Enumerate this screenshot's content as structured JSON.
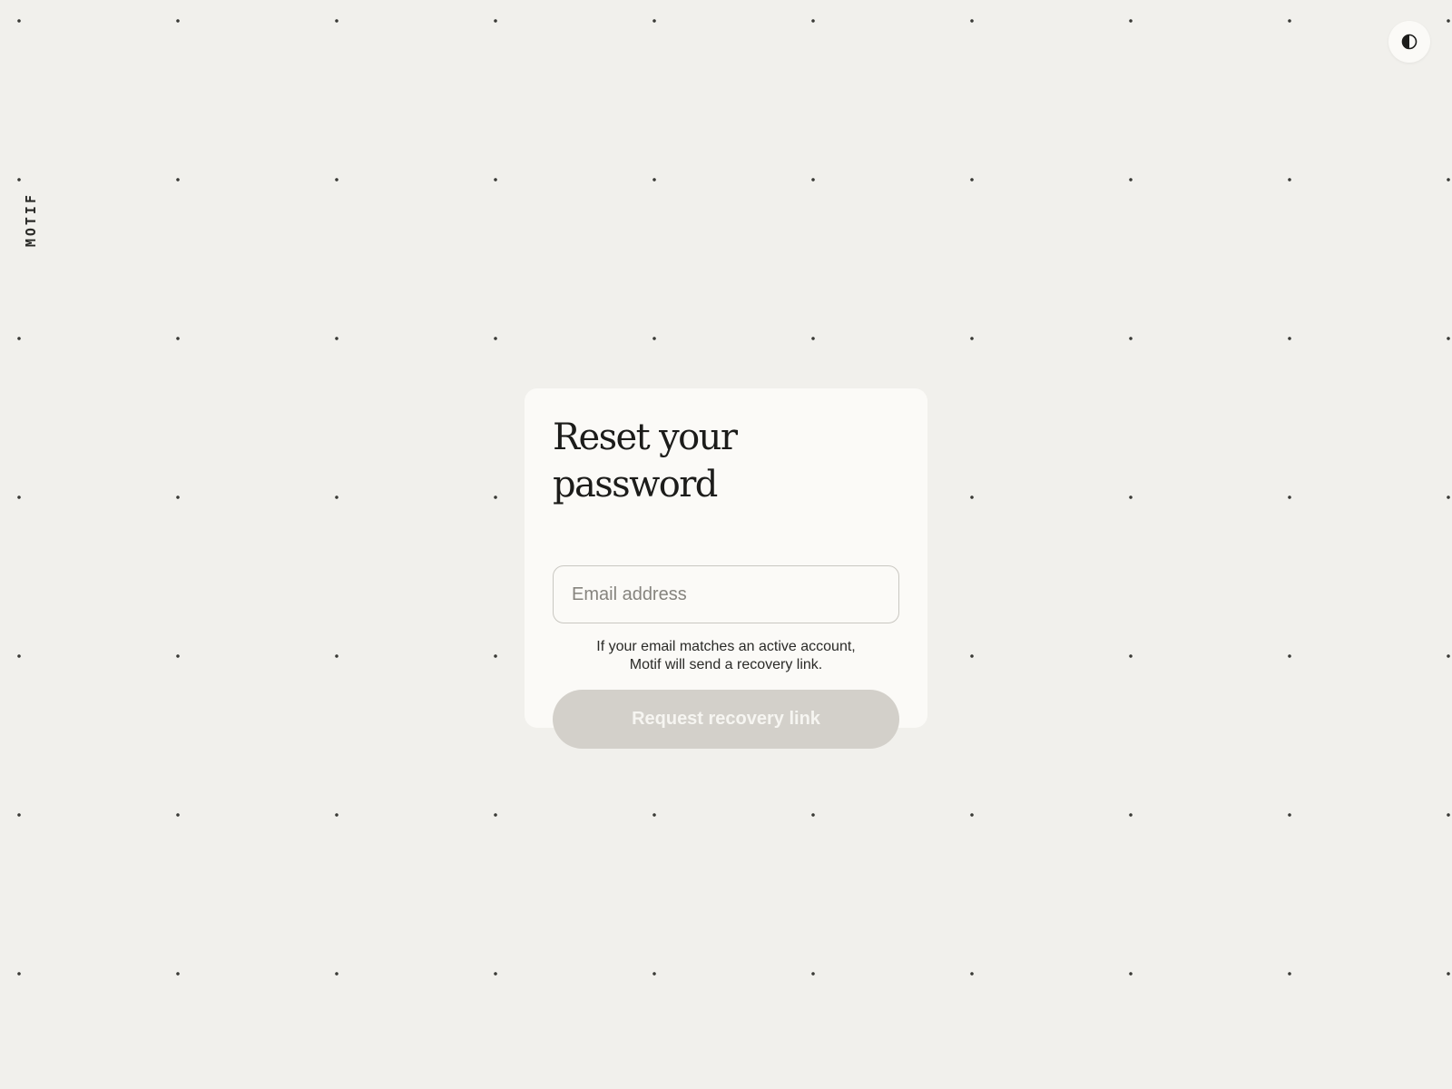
{
  "brand": {
    "name": "MOTIF"
  },
  "theme_toggle": {
    "icon": "half-circle-contrast-icon"
  },
  "card": {
    "title": "Reset your password",
    "email_placeholder": "Email address",
    "email_value": "",
    "hint_line1": "If your email matches an active account,",
    "hint_line2": "Motif will send a recovery link.",
    "submit_label": "Request recovery link",
    "submit_disabled": true
  },
  "colors": {
    "background": "#f1f0ec",
    "card": "#fbfaf7",
    "text": "#1c1c1a",
    "button_disabled_bg": "#d3d0ca",
    "button_disabled_text": "#f6f5f1",
    "dot_grid": "#3a3a36"
  }
}
